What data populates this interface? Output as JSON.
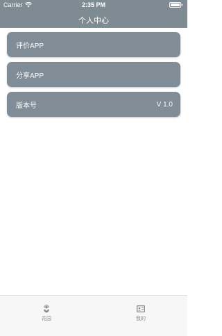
{
  "status_bar": {
    "carrier": "Carrier",
    "time": "2:35 PM"
  },
  "nav": {
    "title": "个人中心"
  },
  "menu": {
    "items": [
      {
        "label": "评价APP",
        "value": ""
      },
      {
        "label": "分享APP",
        "value": ""
      },
      {
        "label": "版本号",
        "value": "V 1.0"
      }
    ]
  },
  "tabbar": {
    "tabs": [
      {
        "label": "花园",
        "icon": "flower-icon"
      },
      {
        "label": "我的",
        "icon": "profile-card-icon"
      }
    ]
  },
  "colors": {
    "nav_background": "#7e8b93",
    "menu_item_background": "#808d96",
    "tab_inactive": "#8a8a8a"
  }
}
